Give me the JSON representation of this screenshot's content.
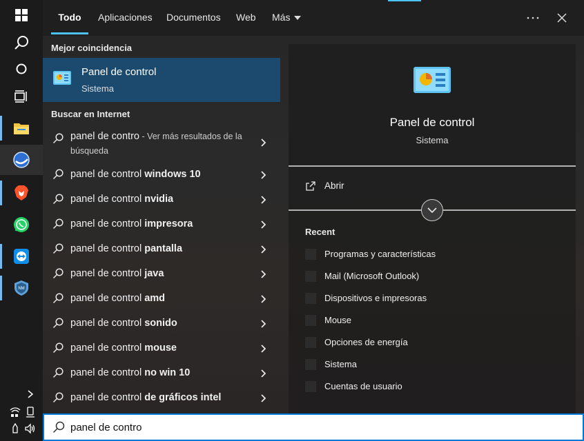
{
  "tabs": [
    {
      "label": "Todo",
      "left": 0
    },
    {
      "label": "Aplicaciones"
    },
    {
      "label": "Documentos"
    },
    {
      "label": "Web"
    },
    {
      "label": "Más"
    }
  ],
  "best_match": {
    "section_title": "Mejor coincidencia",
    "title": "Panel de control",
    "subtitle": "Sistema"
  },
  "internet": {
    "section_title": "Buscar en Internet",
    "first": {
      "query": "panel de contro",
      "hint": " - Ver más resultados de la búsqueda"
    },
    "suggestions": [
      {
        "prefix": "panel de control ",
        "bold": "windows 10"
      },
      {
        "prefix": "panel de control ",
        "bold": "nvidia"
      },
      {
        "prefix": "panel de control ",
        "bold": "impresora"
      },
      {
        "prefix": "panel de control ",
        "bold": "pantalla"
      },
      {
        "prefix": "panel de control ",
        "bold": "java"
      },
      {
        "prefix": "panel de control ",
        "bold": "amd"
      },
      {
        "prefix": "panel de control ",
        "bold": "sonido"
      },
      {
        "prefix": "panel de control ",
        "bold": "mouse"
      },
      {
        "prefix": "panel de control ",
        "bold": "no win 10"
      },
      {
        "prefix": "panel de control ",
        "bold": "de gráficos intel"
      }
    ]
  },
  "preview": {
    "title": "Panel de control",
    "subtitle": "Sistema",
    "open_label": "Abrir",
    "recent_title": "Recent",
    "recent": [
      "Programas y características",
      "Mail (Microsoft Outlook)",
      "Dispositivos e impresoras",
      "Mouse",
      "Opciones de energía",
      "Sistema",
      "Cuentas de usuario"
    ]
  },
  "search": {
    "value": "panel de contro"
  },
  "colors": {
    "accent": "#4cc2ff",
    "selection": "#1c4a6e",
    "border": "#0078d4"
  }
}
